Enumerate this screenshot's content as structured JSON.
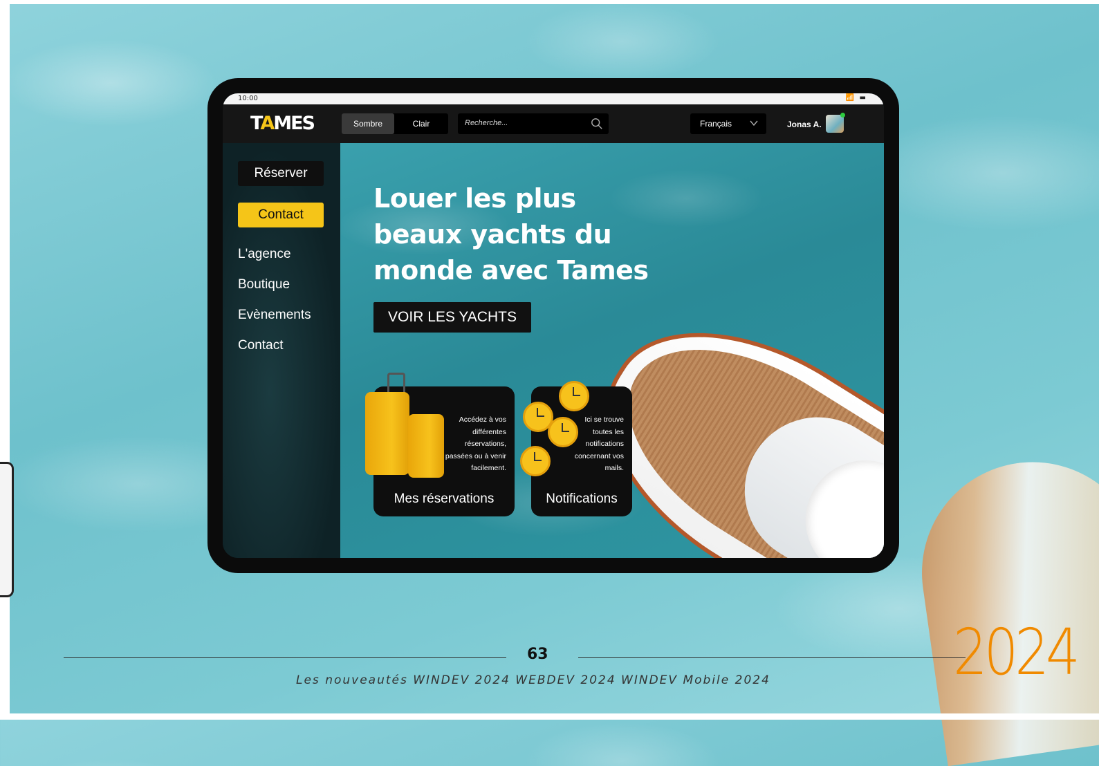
{
  "statusbar": {
    "time": "10:00",
    "icons": "📶 ▬"
  },
  "navbar": {
    "logo_prefix": "T",
    "logo_accent": "A",
    "logo_suffix": "MES",
    "theme_dark": "Sombre",
    "theme_light": "Clair",
    "search_placeholder": "Recherche...",
    "language": "Français",
    "user_name": "Jonas A."
  },
  "sidebar": {
    "reserve_label": "Réserver",
    "contact_label": "Contact",
    "links": [
      "L'agence",
      "Boutique",
      "Evènements",
      "Contact"
    ]
  },
  "hero": {
    "title": "Louer les plus beaux yachts du monde avec Tames",
    "cta_label": "VOIR LES YACHTS"
  },
  "cards": [
    {
      "description": "Accédez à vos différentes réservations, passées ou à venir facilement.",
      "title": "Mes réservations"
    },
    {
      "description": "Ici se trouve toutes les notifications concernant vos mails.",
      "title": "Notifications"
    }
  ],
  "footer": {
    "page_number": "63",
    "text": "Les nouveautés WINDEV 2024   WEBDEV 2024   WINDEV Mobile 2024",
    "year": "2024"
  },
  "colors": {
    "accent_yellow": "#f5c518",
    "year_orange": "#f08a00",
    "navbar_bg": "#161616"
  }
}
